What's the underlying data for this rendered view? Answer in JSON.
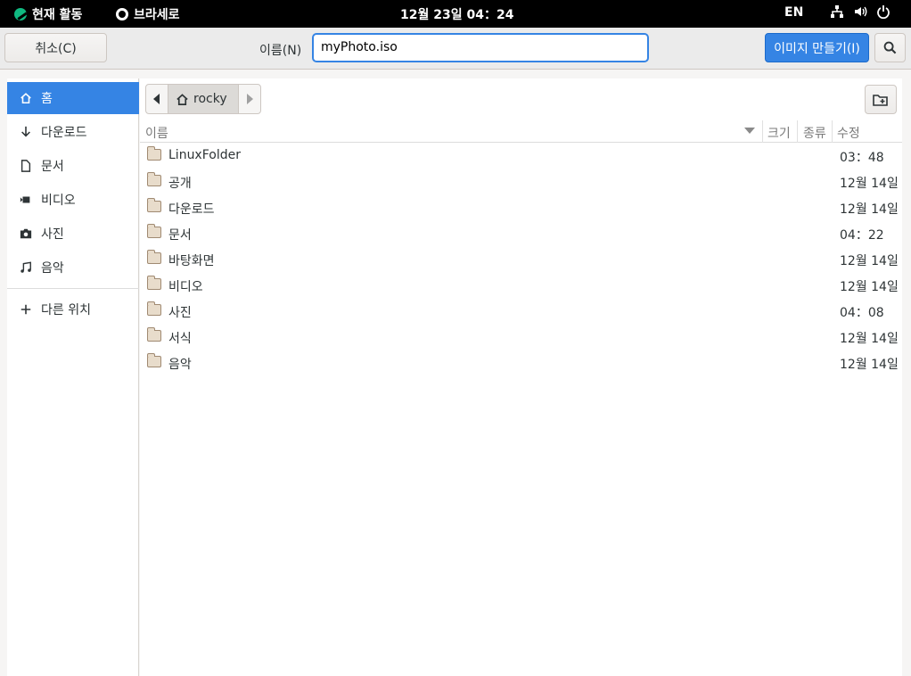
{
  "topbar": {
    "activities": "현재 활동",
    "app": "브라세로",
    "clock": "12월 23일  04：24",
    "lang": "EN"
  },
  "header": {
    "cancel": "취소(C)",
    "name_label": "이름(N)",
    "filename": "myPhoto.iso",
    "create": "이미지 만들기(I)"
  },
  "sidebar": {
    "items": [
      {
        "label": "홈",
        "icon": "home-icon"
      },
      {
        "label": "다운로드",
        "icon": "download-icon"
      },
      {
        "label": "문서",
        "icon": "document-icon"
      },
      {
        "label": "비디오",
        "icon": "video-icon"
      },
      {
        "label": "사진",
        "icon": "camera-icon"
      },
      {
        "label": "음악",
        "icon": "music-icon"
      }
    ],
    "other": "다른 위치"
  },
  "path": {
    "crumb": "rocky"
  },
  "columns": {
    "name": "이름",
    "size": "크기",
    "type": "종류",
    "modified": "수정"
  },
  "files": [
    {
      "name": "LinuxFolder",
      "modified": "03：48"
    },
    {
      "name": "공개",
      "modified": "12월 14일"
    },
    {
      "name": "다운로드",
      "modified": "12월 14일"
    },
    {
      "name": "문서",
      "modified": "04：22"
    },
    {
      "name": "바탕화면",
      "modified": "12월 14일"
    },
    {
      "name": "비디오",
      "modified": "12월 14일"
    },
    {
      "name": "사진",
      "modified": "04：08"
    },
    {
      "name": "서식",
      "modified": "12월 14일"
    },
    {
      "name": "음악",
      "modified": "12월 14일"
    }
  ],
  "colors": {
    "accent": "#3584e4",
    "topbar": "#000000",
    "folder": "#e8dccb"
  }
}
